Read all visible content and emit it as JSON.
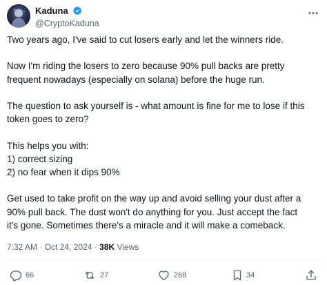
{
  "author": {
    "display_name": "Kaduna",
    "handle": "@CryptoKaduna",
    "verified": true,
    "verified_color": "#1d9bf0"
  },
  "tweet": {
    "lines": [
      "Two years ago, I've said to cut losers early and let the winners ride.",
      "",
      "Now I'm riding the losers to zero because 90% pull backs are pretty",
      "frequent nowadays (especially on solana) before the huge run.",
      "",
      "The question to ask yourself is - what amount is fine for me to lose if this",
      "token goes to zero?",
      "",
      "This helps you with:",
      "1) correct sizing",
      "2) no fear when it dips 90%",
      "",
      "Get used to take profit on the way up and avoid selling your dust after a",
      "90% pull back. The dust won't do anything for you. Just accept the fact",
      "it's gone. Sometimes there's a miracle and it will make a comeback."
    ]
  },
  "meta": {
    "time": "7:32 AM",
    "separator": "·",
    "date": "Oct 24, 2024",
    "views_count": "38K",
    "views_label": "Views"
  },
  "actions": {
    "replies": "66",
    "reposts": "27",
    "likes": "268",
    "bookmarks": "34"
  },
  "icons": {
    "more": "more-horizontal-icon",
    "reply": "reply-icon",
    "repost": "repost-icon",
    "like": "heart-icon",
    "bookmark": "bookmark-icon",
    "share": "share-icon"
  },
  "colors": {
    "text": "#0f1419",
    "secondary": "#536471",
    "divider": "#eff3f4"
  }
}
